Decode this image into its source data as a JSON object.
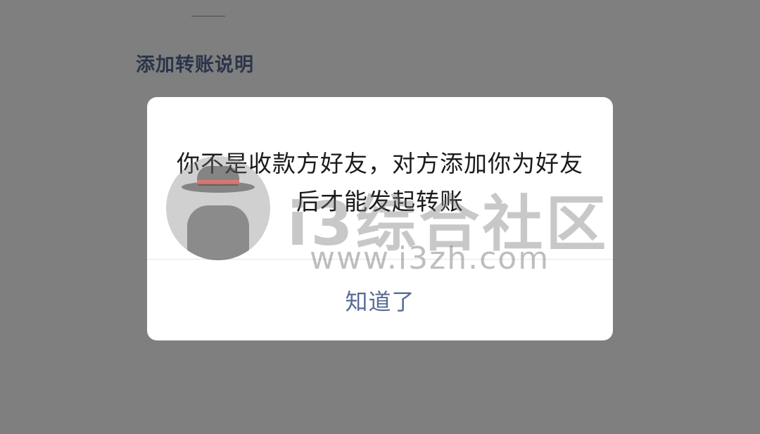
{
  "page": {
    "link_text": "添加转账说明"
  },
  "dialog": {
    "message": "你不是收款方好友，对方添加你为好友后才能发起转账",
    "confirm_label": "知道了"
  },
  "watermark": {
    "title": "i3综合社区",
    "url": "www.i3zh.com"
  },
  "colors": {
    "link": "#576b95",
    "overlay": "rgba(0,0,0,0.5)",
    "dialog_bg": "#ffffff"
  }
}
